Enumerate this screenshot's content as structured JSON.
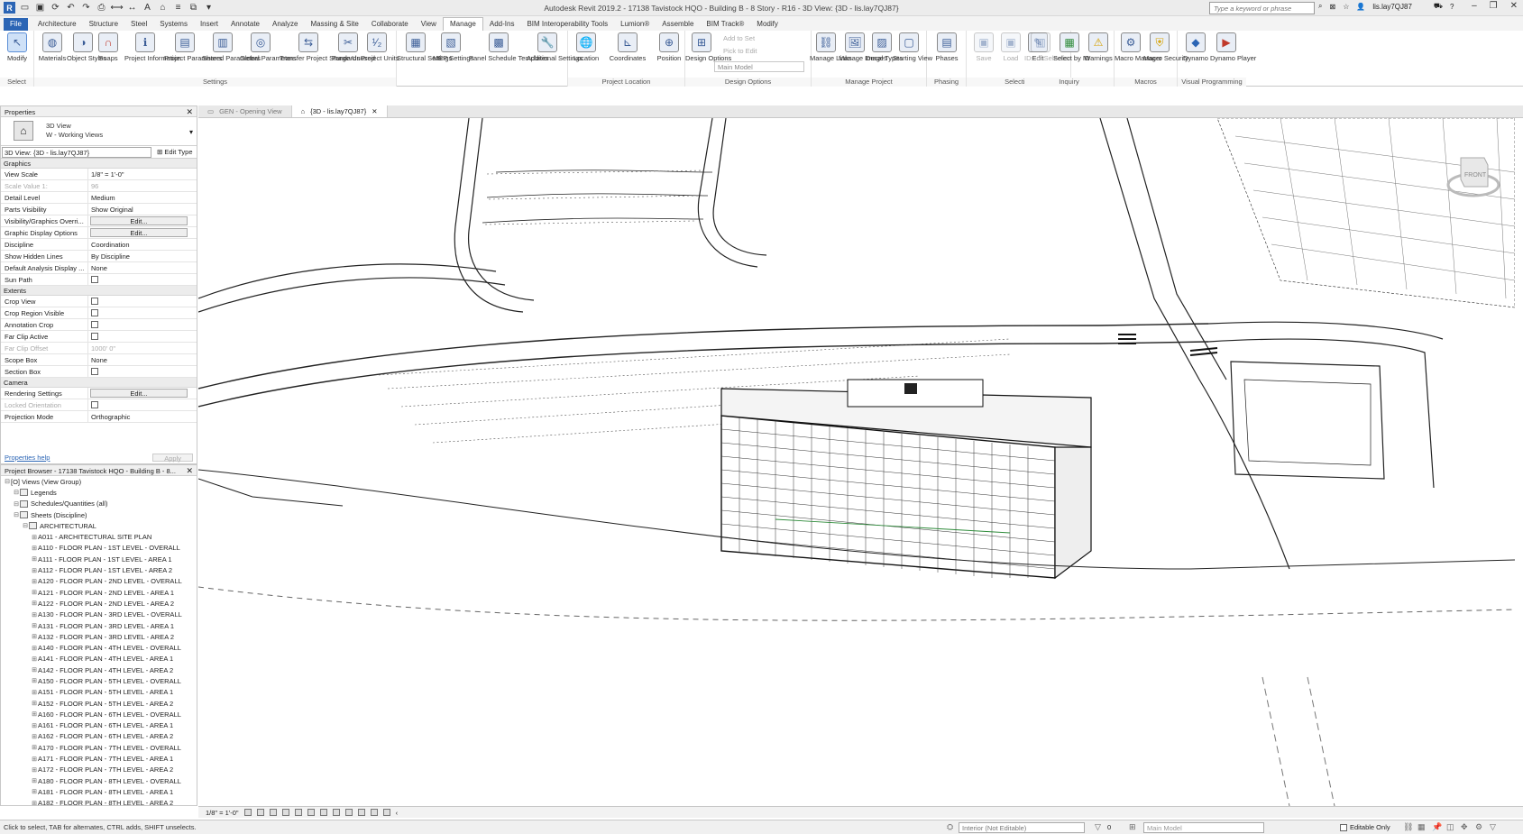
{
  "title_bar": {
    "title": "Autodesk Revit 2019.2 - 17138 Tavistock HQO - Building B - 8 Story - R16 - 3D View: {3D - lis.lay7QJ87}",
    "search_placeholder": "Type a keyword or phrase",
    "user": "lis.lay7QJ87",
    "logo": "R",
    "help": "?"
  },
  "ribbon_tabs": [
    "File",
    "Architecture",
    "Structure",
    "Steel",
    "Systems",
    "Insert",
    "Annotate",
    "Analyze",
    "Massing & Site",
    "Collaborate",
    "View",
    "Manage",
    "Add-Ins",
    "BIM Interoperability Tools",
    "Lumion®",
    "Assemble",
    "BIM Track®",
    "Modify"
  ],
  "active_tab": "Manage",
  "ribbon_groups": {
    "select": "Select",
    "settings": "Settings",
    "project_location": "Project Location",
    "design_options": "Design Options",
    "manage_project": "Manage Project",
    "phasing": "Phasing",
    "selection": "Selection",
    "inquiry": "Inquiry",
    "macros": "Macros",
    "visual_programming": "Visual Programming"
  },
  "ribbon_buttons": {
    "modify": "Modify",
    "materials": "Materials",
    "object_styles": "Object Styles",
    "snaps": "Snaps",
    "project_information": "Project Information",
    "project_parameters": "Project Parameters",
    "shared_parameters": "Shared Parameters",
    "global_parameters": "Global Parameters",
    "transfer_standards": "Transfer Project Standards",
    "purge_unused": "Purge Unused",
    "project_units": "Project Units",
    "structural_settings": "Structural Settings",
    "mep_settings": "MEP Settings",
    "panel_schedule_templates": "Panel Schedule Templates",
    "additional_settings": "Additional Settings",
    "location": "Location",
    "coordinates": "Coordinates",
    "position": "Position",
    "design_options": "Design Options",
    "add_to_set": "Add to Set",
    "pick_to_edit": "Pick to Edit",
    "main_model": "Main Model",
    "manage_links": "Manage Links",
    "manage_images": "Manage Images",
    "decal_types": "Decal Types",
    "starting_view": "Starting View",
    "phases": "Phases",
    "save": "Save",
    "load": "Load",
    "edit": "Edit",
    "ids_of_selection": "IDs of Selection",
    "select_by_id": "Select by ID",
    "warnings": "Warnings",
    "macro_manager": "Macro Manager",
    "macro_security": "Macro Security",
    "dynamo": "Dynamo",
    "dynamo_player": "Dynamo Player"
  },
  "properties": {
    "header": "Properties",
    "type_name_line1": "3D View",
    "type_name_line2": "W - Working Views",
    "view_selector": "3D View: {3D - lis.lay7QJ87}",
    "edit_type": "Edit Type",
    "categories": {
      "graphics": "Graphics",
      "extents": "Extents",
      "camera": "Camera"
    },
    "graphics_rows": [
      {
        "name": "View Scale",
        "value": "1/8\" = 1'-0\""
      },
      {
        "name": "Scale Value    1:",
        "value": "96"
      },
      {
        "name": "Detail Level",
        "value": "Medium"
      },
      {
        "name": "Parts Visibility",
        "value": "Show Original"
      },
      {
        "name": "Visibility/Graphics Overri...",
        "value": "Edit..."
      },
      {
        "name": "Graphic Display Options",
        "value": "Edit..."
      },
      {
        "name": "Discipline",
        "value": "Coordination"
      },
      {
        "name": "Show Hidden Lines",
        "value": "By Discipline"
      },
      {
        "name": "Default Analysis Display ...",
        "value": "None"
      },
      {
        "name": "Sun Path",
        "value": ""
      }
    ],
    "extents_rows": [
      {
        "name": "Crop View",
        "value": ""
      },
      {
        "name": "Crop Region Visible",
        "value": ""
      },
      {
        "name": "Annotation Crop",
        "value": ""
      },
      {
        "name": "Far Clip Active",
        "value": ""
      },
      {
        "name": "Far Clip Offset",
        "value": "1000' 0\""
      },
      {
        "name": "Scope Box",
        "value": "None"
      },
      {
        "name": "Section Box",
        "value": ""
      }
    ],
    "camera_rows": [
      {
        "name": "Rendering Settings",
        "value": "Edit..."
      },
      {
        "name": "Locked Orientation",
        "value": ""
      },
      {
        "name": "Projection Mode",
        "value": "Orthographic"
      }
    ],
    "help_link": "Properties help",
    "apply": "Apply"
  },
  "project_browser": {
    "header": "Project Browser - 17138 Tavistock HQO - Building B - 8...",
    "items": [
      {
        "label": "[O] Views (View Group)",
        "level": 0
      },
      {
        "label": "Legends",
        "level": 1
      },
      {
        "label": "Schedules/Quantities (all)",
        "level": 1
      },
      {
        "label": "Sheets (Discipline)",
        "level": 1
      },
      {
        "label": "ARCHITECTURAL",
        "level": 2
      },
      {
        "label": "A011 - ARCHITECTURAL SITE PLAN",
        "level": 3
      },
      {
        "label": "A110 - FLOOR PLAN - 1ST LEVEL - OVERALL",
        "level": 3
      },
      {
        "label": "A111 - FLOOR PLAN - 1ST LEVEL - AREA 1",
        "level": 3
      },
      {
        "label": "A112 - FLOOR PLAN - 1ST LEVEL - AREA 2",
        "level": 3
      },
      {
        "label": "A120 - FLOOR PLAN - 2ND LEVEL - OVERALL",
        "level": 3
      },
      {
        "label": "A121 - FLOOR PLAN - 2ND LEVEL - AREA 1",
        "level": 3
      },
      {
        "label": "A122 - FLOOR PLAN - 2ND LEVEL - AREA 2",
        "level": 3
      },
      {
        "label": "A130 - FLOOR PLAN - 3RD LEVEL - OVERALL",
        "level": 3
      },
      {
        "label": "A131 - FLOOR PLAN - 3RD LEVEL - AREA 1",
        "level": 3
      },
      {
        "label": "A132 - FLOOR PLAN - 3RD LEVEL - AREA 2",
        "level": 3
      },
      {
        "label": "A140 - FLOOR PLAN - 4TH LEVEL - OVERALL",
        "level": 3
      },
      {
        "label": "A141 - FLOOR PLAN - 4TH LEVEL - AREA 1",
        "level": 3
      },
      {
        "label": "A142 - FLOOR PLAN - 4TH LEVEL - AREA 2",
        "level": 3
      },
      {
        "label": "A150 - FLOOR PLAN - 5TH LEVEL - OVERALL",
        "level": 3
      },
      {
        "label": "A151 - FLOOR PLAN - 5TH LEVEL - AREA 1",
        "level": 3
      },
      {
        "label": "A152 - FLOOR PLAN - 5TH LEVEL - AREA 2",
        "level": 3
      },
      {
        "label": "A160 - FLOOR PLAN - 6TH LEVEL - OVERALL",
        "level": 3
      },
      {
        "label": "A161 - FLOOR PLAN - 6TH LEVEL - AREA 1",
        "level": 3
      },
      {
        "label": "A162 - FLOOR PLAN - 6TH LEVEL - AREA 2",
        "level": 3
      },
      {
        "label": "A170 - FLOOR PLAN - 7TH LEVEL - OVERALL",
        "level": 3
      },
      {
        "label": "A171 - FLOOR PLAN - 7TH LEVEL - AREA 1",
        "level": 3
      },
      {
        "label": "A172 - FLOOR PLAN - 7TH LEVEL - AREA 2",
        "level": 3
      },
      {
        "label": "A180 - FLOOR PLAN - 8TH LEVEL - OVERALL",
        "level": 3
      },
      {
        "label": "A181 - FLOOR PLAN - 8TH LEVEL - AREA 1",
        "level": 3
      },
      {
        "label": "A182 - FLOOR PLAN - 8TH LEVEL - AREA 2",
        "level": 3
      }
    ]
  },
  "view_tabs": [
    {
      "label": "GEN - Opening View",
      "active": false
    },
    {
      "label": "{3D - lis.lay7QJ87}",
      "active": true
    }
  ],
  "viewcube_label": "FRONT",
  "view_control": {
    "scale": "1/8\" = 1'-0\""
  },
  "status_bar": {
    "message": "Click to select, TAB for alternates, CTRL adds, SHIFT unselects.",
    "workset": "Interior (Not Editable)",
    "model": "Main Model",
    "editable_only": "Editable Only",
    "count": "0"
  },
  "colors": {
    "accent": "#2b65b5",
    "ribbon_bg": "#ffffff",
    "status_bg": "#f0f0f0"
  }
}
